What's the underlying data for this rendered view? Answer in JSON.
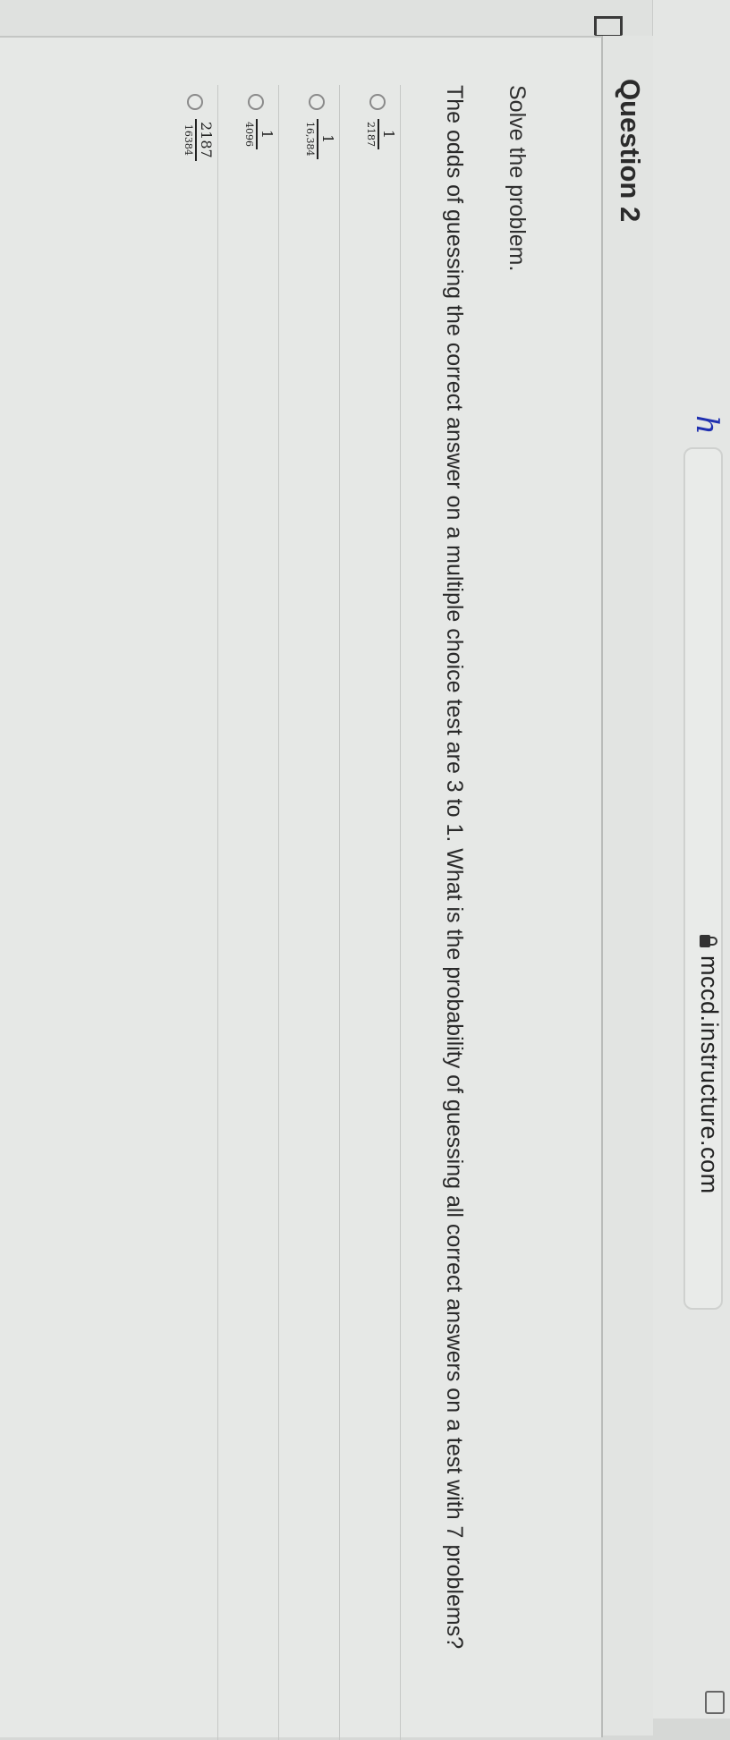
{
  "browser": {
    "url": "mccd.instructure.com",
    "handwritten_note": "ℎ"
  },
  "question": {
    "title": "Question 2",
    "instruction": "Solve the problem.",
    "text": "The odds of guessing the correct answer on a multiple choice test are 3 to 1. What is the probability of guessing all correct answers on a test with 7 problems?",
    "answers": [
      {
        "numerator": "1",
        "denominator": "2187"
      },
      {
        "numerator": "1",
        "denominator": "16,384"
      },
      {
        "numerator": "1",
        "denominator": "4096"
      },
      {
        "numerator": "2187",
        "denominator": "16384"
      }
    ]
  },
  "icons": {
    "lock": "lock-icon",
    "flag": "flag-icon",
    "reader": "reader-view-icon",
    "radio": "radio-button-icon"
  }
}
